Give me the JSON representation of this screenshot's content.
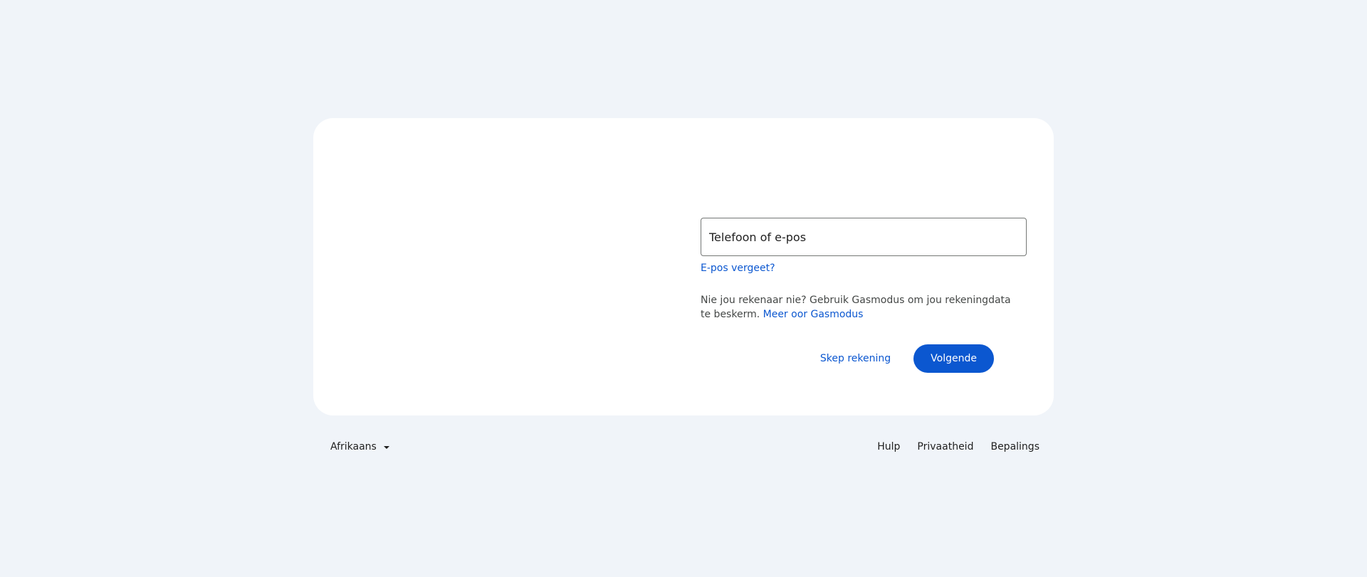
{
  "login": {
    "input_placeholder": "Telefoon of e-pos",
    "forgot_email": "E-pos vergeet?",
    "guest_text": "Nie jou rekenaar nie? Gebruik Gasmodus om jou rekeningdata te beskerm.",
    "guest_link": "Meer oor Gasmodus",
    "create_account": "Skep rekening",
    "next": "Volgende"
  },
  "footer": {
    "language": "Afrikaans",
    "links": [
      "Hulp",
      "Privaatheid",
      "Bepalings"
    ]
  },
  "colors": {
    "background": "#f0f4f9",
    "card": "#ffffff",
    "accent": "#0b57d0"
  }
}
